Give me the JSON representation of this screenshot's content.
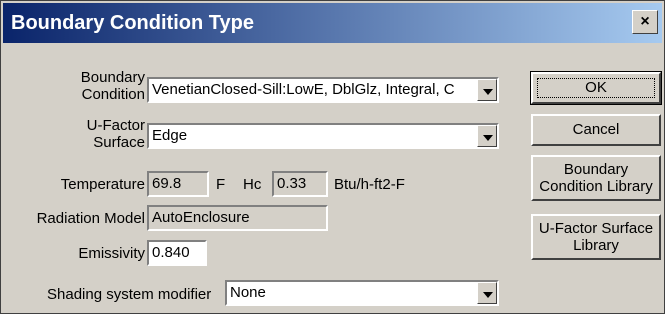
{
  "window": {
    "title": "Boundary Condition Type",
    "close_glyph": "×"
  },
  "form": {
    "boundary_condition": {
      "label_line1": "Boundary",
      "label_line2": "Condition",
      "value": "VenetianClosed-Sill:LowE, DblGlz, Integral, C"
    },
    "ufactor_surface": {
      "label_line1": "U-Factor",
      "label_line2": "Surface",
      "value": "Edge"
    },
    "temperature": {
      "label": "Temperature",
      "value": "69.8",
      "unit": "F"
    },
    "hc": {
      "label": "Hc",
      "value": "0.33",
      "unit": "Btu/h-ft2-F"
    },
    "radiation_model": {
      "label": "Radiation Model",
      "value": "AutoEnclosure"
    },
    "emissivity": {
      "label": "Emissivity",
      "value": "0.840"
    },
    "shading_modifier": {
      "label": "Shading system modifier",
      "value": "None"
    }
  },
  "buttons": {
    "ok": "OK",
    "cancel": "Cancel",
    "bc_library_line1": "Boundary",
    "bc_library_line2": "Condition Library",
    "ufs_library_line1": "U-Factor Surface",
    "ufs_library_line2": "Library"
  },
  "colors": {
    "dialog_bg": "#d4d0c8",
    "title_start": "#0a246a",
    "title_end": "#a6caf0"
  }
}
